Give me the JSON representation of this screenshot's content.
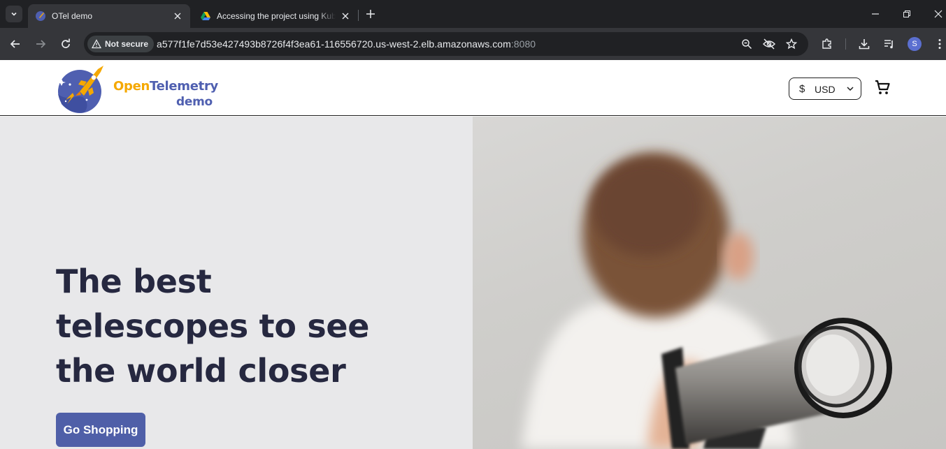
{
  "browser": {
    "tabs": [
      {
        "title": "OTel demo",
        "active": true,
        "favicon": "otel-favicon"
      },
      {
        "title": "Accessing the project using Kubernetes",
        "active": false,
        "favicon": "google-drive-favicon"
      }
    ],
    "security_chip": "Not secure",
    "url_host": "a577f1fe7d53e427493b8726f4f3ea61-116556720.us-west-2.elb.amazonaws.com",
    "url_port": ":8080",
    "profile_initial": "S"
  },
  "header": {
    "logo_line1_a": "Open",
    "logo_line1_b": "Telemetry",
    "logo_line2": "demo",
    "currency_symbol": "$",
    "currency_code": "USD"
  },
  "hero": {
    "headline": "The best telescopes to see the world closer",
    "cta_label": "Go Shopping"
  },
  "colors": {
    "brand_orange": "#f5a800",
    "brand_blue": "#4f5fb0",
    "cta_bg": "#4f5fa8",
    "hero_bg": "#e8e8ea",
    "headline": "#262840"
  }
}
